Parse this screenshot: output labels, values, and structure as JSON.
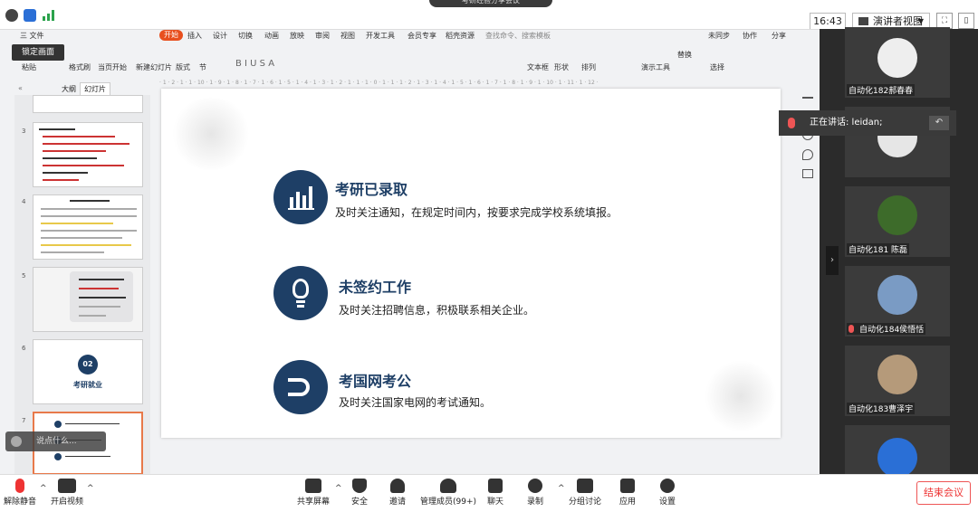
{
  "meeting_title": "考研经验分享会议",
  "timer": "16:43",
  "view_mode": "演讲者视图",
  "app": {
    "menu": [
      "三 文件",
      "开始",
      "插入",
      "设计",
      "切换",
      "动画",
      "放映",
      "审阅",
      "视图",
      "开发工具",
      "会员专享",
      "稻壳资源"
    ],
    "search_placeholder": "查找命令、搜索模板",
    "top_right": [
      "未同步",
      "协作",
      "分享"
    ],
    "ribbon_labels": [
      "粘贴",
      "格式刷",
      "当页开始",
      "新建幻灯片",
      "版式",
      "节",
      "文本框",
      "形状",
      "排列",
      "演示工具",
      "替换",
      "选择"
    ],
    "lock_label": "锁定画面",
    "panel_tabs": [
      "大纲",
      "幻灯片"
    ],
    "thumb_numbers": [
      "3",
      "4",
      "5",
      "6",
      "7"
    ],
    "thumb6_badge": "02",
    "thumb6_text": "考研就业",
    "speaker_placeholder": "说点什么..."
  },
  "slide": {
    "items": [
      {
        "title": "考研已录取",
        "desc": "及时关注通知，在规定时间内，按要求完成学校系统填报。",
        "icon": "bar-chart-icon"
      },
      {
        "title": "未签约工作",
        "desc": "及时关注招聘信息，积极联系相关企业。",
        "icon": "lightbulb-icon"
      },
      {
        "title": "考国网考公",
        "desc": "及时关注国家电网的考试通知。",
        "icon": "magnet-icon"
      }
    ]
  },
  "speaking": "正在讲话: leidan;",
  "participants": [
    {
      "name": "自动化182郝春春"
    },
    {
      "name": ""
    },
    {
      "name": "自动化181 陈磊"
    },
    {
      "name": "自动化184侯悟恬"
    },
    {
      "name": "自动化183曹泽宇"
    },
    {
      "name": ""
    }
  ],
  "bottom_bar": {
    "left": [
      {
        "label": "解除静音",
        "icon": "mic-muted-icon"
      },
      {
        "label": "开启视频",
        "icon": "camera-off-icon"
      }
    ],
    "center": [
      {
        "label": "共享屏幕",
        "icon": "share-screen-icon"
      },
      {
        "label": "安全",
        "icon": "shield-icon"
      },
      {
        "label": "邀请",
        "icon": "invite-icon"
      },
      {
        "label": "管理成员(99+)",
        "icon": "members-icon"
      },
      {
        "label": "聊天",
        "icon": "chat-icon"
      },
      {
        "label": "录制",
        "icon": "record-icon"
      },
      {
        "label": "分组讨论",
        "icon": "breakout-icon"
      },
      {
        "label": "应用",
        "icon": "apps-icon"
      },
      {
        "label": "设置",
        "icon": "gear-icon"
      }
    ],
    "end": "结束会议"
  },
  "colors": {
    "accent": "#1e3f66",
    "tab_active": "#e84f1e",
    "end": "#e33333"
  }
}
